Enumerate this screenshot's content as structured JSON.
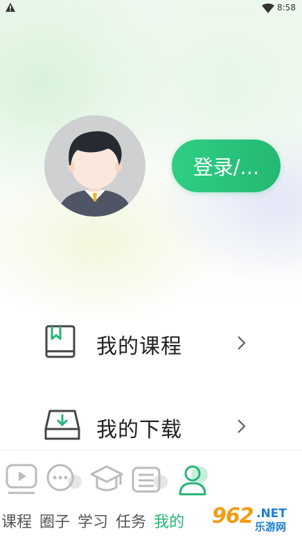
{
  "status_bar": {
    "time": "8:58",
    "left_icon": "alert-triangle-icon",
    "right_icon": "wifi-icon"
  },
  "profile": {
    "login_label": "登录/...",
    "avatar_icon": "user-avatar-icon"
  },
  "menu": [
    {
      "label": "我的课程",
      "icon": "book-bookmark-icon"
    },
    {
      "label": "我的下载",
      "icon": "download-tray-icon"
    }
  ],
  "tabbar": {
    "tabs": [
      {
        "label": "课程",
        "icon": "video-play-icon"
      },
      {
        "label": "圈子",
        "icon": "chat-bubble-icon"
      },
      {
        "label": "学习",
        "icon": "graduation-cap-icon"
      },
      {
        "label": "任务",
        "icon": "task-list-icon"
      },
      {
        "label": "我的",
        "icon": "person-icon",
        "active": true
      }
    ],
    "active_color": "#22b573"
  },
  "watermark": {
    "number": "962",
    "suffix": ".NET",
    "name": "乐游网"
  },
  "colors": {
    "accent": "#22b573",
    "login_gradient_start": "#2fcf83",
    "login_gradient_end": "#23b873"
  }
}
